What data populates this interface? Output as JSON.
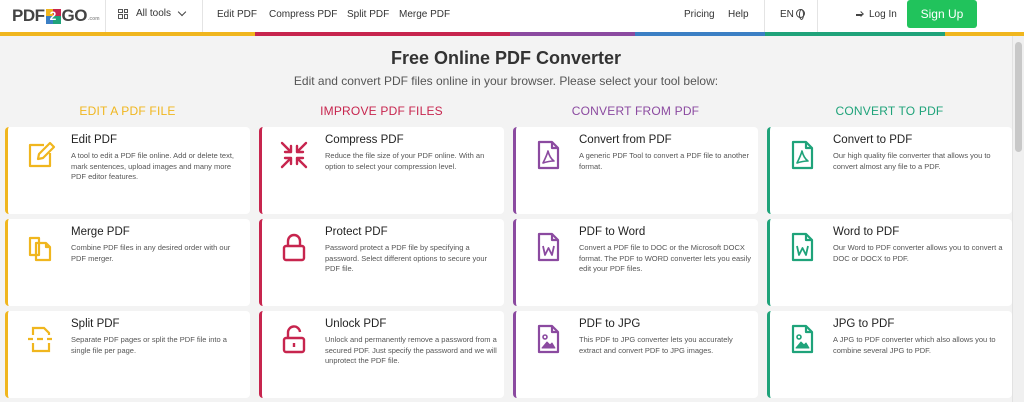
{
  "header": {
    "logo": {
      "pdf": "PDF",
      "two": "2",
      "go": "GO",
      "com": ".com"
    },
    "all_tools": "All tools",
    "nav": [
      "Edit PDF",
      "Compress PDF",
      "Split PDF",
      "Merge PDF"
    ],
    "pricing": "Pricing",
    "help": "Help",
    "language": "EN",
    "login": "Log In",
    "signup": "Sign Up"
  },
  "colors": {
    "edit": "#f0b61e",
    "improve": "#c7254e",
    "convert_from": "#8b4aa0",
    "convert_to": "#1fa37a",
    "signup": "#21c35c",
    "stripe": [
      "#f0b61e",
      "#c7254e",
      "#8b4aa0",
      "#3b7fc4",
      "#1fa37a",
      "#f0b61e"
    ]
  },
  "hero": {
    "title": "Free Online PDF Converter",
    "subtitle": "Edit and convert PDF files online in your browser. Please select your tool below:"
  },
  "columns": [
    {
      "heading": "EDIT A PDF FILE",
      "tools": [
        {
          "icon": "edit-icon",
          "title": "Edit PDF",
          "desc": "A tool to edit a PDF file online. Add or delete text, mark sentences, upload images and many more PDF editor features."
        },
        {
          "icon": "merge-icon",
          "title": "Merge PDF",
          "desc": "Combine PDF files in any desired order with our PDF merger."
        },
        {
          "icon": "split-icon",
          "title": "Split PDF",
          "desc": "Separate PDF pages or split the PDF file into a single file per page."
        }
      ]
    },
    {
      "heading": "IMPROVE PDF FILES",
      "tools": [
        {
          "icon": "compress-icon",
          "title": "Compress PDF",
          "desc": "Reduce the file size of your PDF online. With an option to select your compression level."
        },
        {
          "icon": "lock-icon",
          "title": "Protect PDF",
          "desc": "Password protect a PDF file by specifying a password. Select different options to secure your PDF file."
        },
        {
          "icon": "unlock-icon",
          "title": "Unlock PDF",
          "desc": "Unlock and permanently remove a password from a secured PDF. Just specify the password and we will unprotect the PDF file."
        }
      ]
    },
    {
      "heading": "CONVERT FROM PDF",
      "tools": [
        {
          "icon": "pdf-file-icon",
          "title": "Convert from PDF",
          "desc": "A generic PDF Tool to convert a PDF file to another format."
        },
        {
          "icon": "word-file-icon",
          "title": "PDF to Word",
          "desc": "Convert a PDF file to DOC or the Microsoft DOCX format. The PDF to WORD converter lets you easily edit your PDF files."
        },
        {
          "icon": "image-file-icon",
          "title": "PDF to JPG",
          "desc": "This PDF to JPG converter lets you accurately extract and convert PDF to JPG images."
        }
      ]
    },
    {
      "heading": "CONVERT TO PDF",
      "tools": [
        {
          "icon": "pdf-file-icon",
          "title": "Convert to PDF",
          "desc": "Our high quality file converter that allows you to convert almost any file to a PDF."
        },
        {
          "icon": "word-file-icon",
          "title": "Word to PDF",
          "desc": "Our Word to PDF converter allows you to convert a DOC or DOCX to PDF."
        },
        {
          "icon": "image-file-icon",
          "title": "JPG to PDF",
          "desc": "A JPG to PDF converter which also allows you to combine several JPG to PDF."
        }
      ]
    }
  ]
}
